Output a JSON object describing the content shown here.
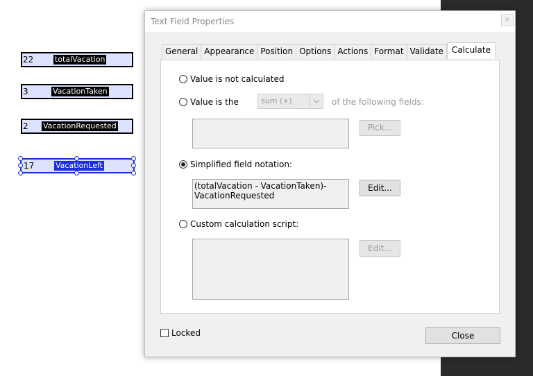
{
  "fields": [
    {
      "value": "22",
      "name": "totalVacation"
    },
    {
      "value": "3",
      "name": "VacationTaken"
    },
    {
      "value": "2",
      "name": "VacationRequested"
    },
    {
      "value": "17",
      "name": "VacationLeft"
    }
  ],
  "dialog": {
    "title": "Text Field Properties",
    "close_glyph": "×",
    "tabs": [
      "General",
      "Appearance",
      "Position",
      "Options",
      "Actions",
      "Format",
      "Validate",
      "Calculate"
    ],
    "options": {
      "not_calculated": "Value is not calculated",
      "value_is_the": "Value is the",
      "operation": "sum (+)",
      "of_following": "of the following fields:",
      "pick": "Pick...",
      "simplified": "Simplified field notation:",
      "notation_text": "(totalVacation - VacationTaken)-\nVacationRequested",
      "edit": "Edit...",
      "custom_script": "Custom calculation script:",
      "edit_disabled": "Edit..."
    },
    "locked": "Locked",
    "close_button": "Close"
  }
}
